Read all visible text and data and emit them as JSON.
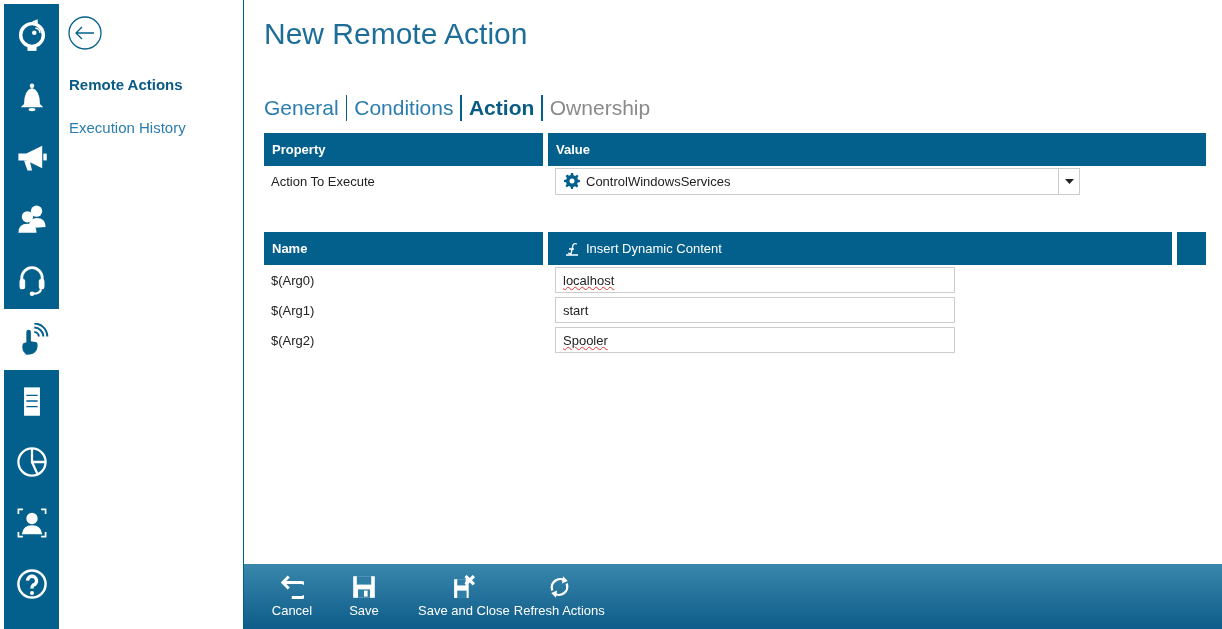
{
  "rail": {
    "items": [
      {
        "kind": "sync-disc",
        "selected": false
      },
      {
        "kind": "bell",
        "selected": false
      },
      {
        "kind": "megaphone",
        "selected": false
      },
      {
        "kind": "users",
        "selected": false
      },
      {
        "kind": "headset",
        "selected": false
      },
      {
        "kind": "touch",
        "selected": true
      },
      {
        "kind": "server",
        "selected": false
      },
      {
        "kind": "pie",
        "selected": false
      },
      {
        "kind": "person",
        "selected": false
      },
      {
        "kind": "help",
        "selected": false
      }
    ]
  },
  "nav": {
    "items": [
      {
        "label": "Remote Actions",
        "selected": true
      },
      {
        "label": "Execution History",
        "selected": false
      }
    ]
  },
  "title": "New Remote Action",
  "tabs": [
    {
      "label": "General",
      "selected": false,
      "disabled": false
    },
    {
      "label": "Conditions",
      "selected": false,
      "disabled": false
    },
    {
      "label": "Action",
      "selected": true,
      "disabled": false
    },
    {
      "label": "Ownership",
      "selected": false,
      "disabled": true
    }
  ],
  "property_table": {
    "columns": [
      "Property",
      "Value"
    ],
    "rows": [
      {
        "property": "Action To Execute",
        "value": "ControlWindowsServices"
      }
    ]
  },
  "arguments_table": {
    "columns": [
      "Name",
      "Insert Dynamic Content"
    ],
    "rows": [
      {
        "name": "$(Arg0)",
        "value": "localhost",
        "spell_error": true
      },
      {
        "name": "$(Arg1)",
        "value": "start",
        "spell_error": false
      },
      {
        "name": "$(Arg2)",
        "value": "Spooler",
        "spell_error": true
      }
    ]
  },
  "toolbar": {
    "buttons": [
      {
        "label": "Cancel",
        "kind": "undo"
      },
      {
        "label": "Save",
        "kind": "save"
      },
      {
        "label": "Save and Close",
        "kind": "save-close"
      },
      {
        "label": "Refresh Actions",
        "kind": "refresh"
      }
    ]
  }
}
